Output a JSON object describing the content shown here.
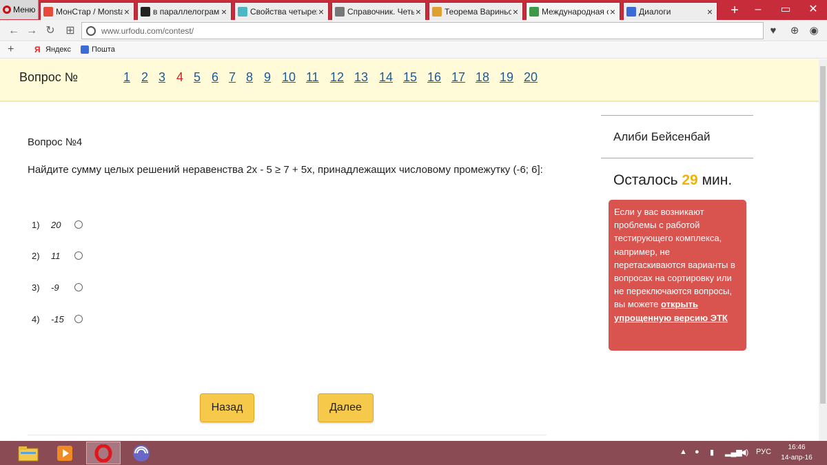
{
  "browser": {
    "menu_label": "Меню",
    "tabs": [
      {
        "title": "МонСтар / Monstar",
        "color": "#e64a3a"
      },
      {
        "title": "в параллелограмме",
        "color": "#222222"
      },
      {
        "title": "Свойства четырехуг",
        "color": "#4bb7c4"
      },
      {
        "title": "Справочник. Четыр",
        "color": "#777777"
      },
      {
        "title": "Теорема Вариньона",
        "color": "#e0a030"
      },
      {
        "title": "Международная олим",
        "color": "#3c9a48"
      },
      {
        "title": "Диалоги",
        "color": "#3b6bd6"
      }
    ],
    "url": "www.urfodu.com/contest/",
    "bookmarks": [
      "Яндекс",
      "Пошта"
    ]
  },
  "question_nav": {
    "label": "Вопрос №",
    "numbers": [
      "1",
      "2",
      "3",
      "4",
      "5",
      "6",
      "7",
      "8",
      "9",
      "10",
      "11",
      "12",
      "13",
      "14",
      "15",
      "16",
      "17",
      "18",
      "19",
      "20"
    ],
    "current": "4"
  },
  "question": {
    "title": "Вопрос №4",
    "text": "Найдите сумму целых решений неравенства 2x - 5 ≥ 7 + 5x, принадлежащих числовому промежутку (-6; 6]:",
    "answers": [
      {
        "num": "1)",
        "value": "20"
      },
      {
        "num": "2)",
        "value": "11"
      },
      {
        "num": "3)",
        "value": "-9"
      },
      {
        "num": "4)",
        "value": "-15"
      }
    ]
  },
  "buttons": {
    "back": "Назад",
    "next": "Далее"
  },
  "sidebar": {
    "user": "Алиби Бейсенбай",
    "timer_prefix": "Осталось",
    "timer_value": "29",
    "timer_suffix": "мин.",
    "alert_text": "Если у вас возникают проблемы с работой тестирующего комплекса, например, не перетаскиваются варианты в вопросах на сортировку или не переключаются вопросы, вы можете",
    "alert_link": "открыть упрощенную версию ЭТК"
  },
  "taskbar": {
    "lang": "РУС",
    "time": "16:46",
    "date": "14-апр-16"
  },
  "colors": {
    "accent_red": "#d9534f",
    "timer_yellow": "#f0b400",
    "link_blue": "#1b5b9c",
    "button_yellow": "#f7c94a"
  }
}
